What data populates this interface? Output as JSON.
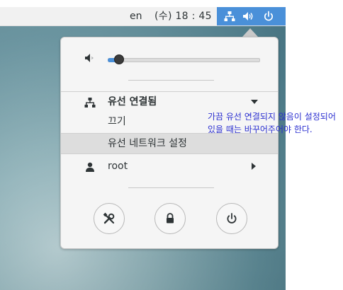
{
  "topbar": {
    "language": "en",
    "clock": "(수) 18 : 45",
    "status_icons": [
      "network-wired-icon",
      "speaker-volume-icon",
      "power-icon"
    ],
    "accent_color": "#4a90d9"
  },
  "system_menu": {
    "volume": {
      "icon": "speaker-muted-icon",
      "level": 0.07
    },
    "wired_connection": {
      "title": "유선 연결됨",
      "items": [
        {
          "label": "끄기"
        },
        {
          "label": "유선 네트워크 설정"
        }
      ]
    },
    "user": {
      "name": "root"
    },
    "action_buttons": [
      "settings-icon",
      "lock-icon",
      "power-icon"
    ]
  },
  "annotation": {
    "text": "가끔 유선 연결되지 않음이 설정되어있을 때는 바꾸어주어야 한다.",
    "color": "#2b2fd0"
  }
}
